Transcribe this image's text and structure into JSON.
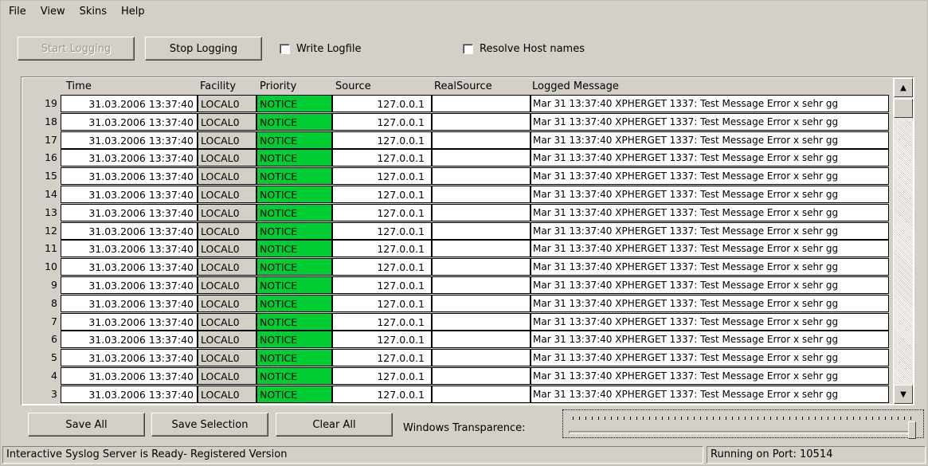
{
  "menu": {
    "file": "File",
    "view": "View",
    "skins": "Skins",
    "help": "Help"
  },
  "toolbar": {
    "start_logging": "Start Logging",
    "stop_logging": "Stop Logging",
    "write_logfile": "Write Logfile",
    "resolve_host_names": "Resolve Host names"
  },
  "table": {
    "columns": {
      "time": "Time",
      "facility": "Facility",
      "priority": "Priority",
      "source": "Source",
      "realsource": "RealSource",
      "message": "Logged Message"
    },
    "priority_color": "#00cc33",
    "rows": [
      {
        "num": "19",
        "time": "31.03.2006 13:37:40",
        "facility": "LOCAL0",
        "priority": "NOTICE",
        "source": "127.0.0.1",
        "realsource": "",
        "message": "Mar 31 13:37:40 XPHERGET 1337: Test Message Error x sehr gg"
      },
      {
        "num": "18",
        "time": "31.03.2006 13:37:40",
        "facility": "LOCAL0",
        "priority": "NOTICE",
        "source": "127.0.0.1",
        "realsource": "",
        "message": "Mar 31 13:37:40 XPHERGET 1337: Test Message Error x sehr gg"
      },
      {
        "num": "17",
        "time": "31.03.2006 13:37:40",
        "facility": "LOCAL0",
        "priority": "NOTICE",
        "source": "127.0.0.1",
        "realsource": "",
        "message": "Mar 31 13:37:40 XPHERGET 1337: Test Message Error x sehr gg"
      },
      {
        "num": "16",
        "time": "31.03.2006 13:37:40",
        "facility": "LOCAL0",
        "priority": "NOTICE",
        "source": "127.0.0.1",
        "realsource": "",
        "message": "Mar 31 13:37:40 XPHERGET 1337: Test Message Error x sehr gg"
      },
      {
        "num": "15",
        "time": "31.03.2006 13:37:40",
        "facility": "LOCAL0",
        "priority": "NOTICE",
        "source": "127.0.0.1",
        "realsource": "",
        "message": "Mar 31 13:37:40 XPHERGET 1337: Test Message Error x sehr gg"
      },
      {
        "num": "14",
        "time": "31.03.2006 13:37:40",
        "facility": "LOCAL0",
        "priority": "NOTICE",
        "source": "127.0.0.1",
        "realsource": "",
        "message": "Mar 31 13:37:40 XPHERGET 1337: Test Message Error x sehr gg"
      },
      {
        "num": "13",
        "time": "31.03.2006 13:37:40",
        "facility": "LOCAL0",
        "priority": "NOTICE",
        "source": "127.0.0.1",
        "realsource": "",
        "message": "Mar 31 13:37:40 XPHERGET 1337: Test Message Error x sehr gg"
      },
      {
        "num": "12",
        "time": "31.03.2006 13:37:40",
        "facility": "LOCAL0",
        "priority": "NOTICE",
        "source": "127.0.0.1",
        "realsource": "",
        "message": "Mar 31 13:37:40 XPHERGET 1337: Test Message Error x sehr gg"
      },
      {
        "num": "11",
        "time": "31.03.2006 13:37:40",
        "facility": "LOCAL0",
        "priority": "NOTICE",
        "source": "127.0.0.1",
        "realsource": "",
        "message": "Mar 31 13:37:40 XPHERGET 1337: Test Message Error x sehr gg"
      },
      {
        "num": "10",
        "time": "31.03.2006 13:37:40",
        "facility": "LOCAL0",
        "priority": "NOTICE",
        "source": "127.0.0.1",
        "realsource": "",
        "message": "Mar 31 13:37:40 XPHERGET 1337: Test Message Error x sehr gg"
      },
      {
        "num": "9",
        "time": "31.03.2006 13:37:40",
        "facility": "LOCAL0",
        "priority": "NOTICE",
        "source": "127.0.0.1",
        "realsource": "",
        "message": "Mar 31 13:37:40 XPHERGET 1337: Test Message Error x sehr gg"
      },
      {
        "num": "8",
        "time": "31.03.2006 13:37:40",
        "facility": "LOCAL0",
        "priority": "NOTICE",
        "source": "127.0.0.1",
        "realsource": "",
        "message": "Mar 31 13:37:40 XPHERGET 1337: Test Message Error x sehr gg"
      },
      {
        "num": "7",
        "time": "31.03.2006 13:37:40",
        "facility": "LOCAL0",
        "priority": "NOTICE",
        "source": "127.0.0.1",
        "realsource": "",
        "message": "Mar 31 13:37:40 XPHERGET 1337: Test Message Error x sehr gg"
      },
      {
        "num": "6",
        "time": "31.03.2006 13:37:40",
        "facility": "LOCAL0",
        "priority": "NOTICE",
        "source": "127.0.0.1",
        "realsource": "",
        "message": "Mar 31 13:37:40 XPHERGET 1337: Test Message Error x sehr gg"
      },
      {
        "num": "5",
        "time": "31.03.2006 13:37:40",
        "facility": "LOCAL0",
        "priority": "NOTICE",
        "source": "127.0.0.1",
        "realsource": "",
        "message": "Mar 31 13:37:40 XPHERGET 1337: Test Message Error x sehr gg"
      },
      {
        "num": "4",
        "time": "31.03.2006 13:37:40",
        "facility": "LOCAL0",
        "priority": "NOTICE",
        "source": "127.0.0.1",
        "realsource": "",
        "message": "Mar 31 13:37:40 XPHERGET 1337: Test Message Error x sehr gg"
      },
      {
        "num": "3",
        "time": "31.03.2006 13:37:40",
        "facility": "LOCAL0",
        "priority": "NOTICE",
        "source": "127.0.0.1",
        "realsource": "",
        "message": "Mar 31 13:37:40 XPHERGET 1337: Test Message Error x sehr gg"
      }
    ]
  },
  "bottom": {
    "save_all": "Save All",
    "save_selection": "Save Selection",
    "clear_all": "Clear All",
    "transparence_label": "Windows Transparence:",
    "transparence_level_percent": 100
  },
  "status": {
    "left": "Interactive Syslog Server is Ready- Registered Version",
    "right": "Running on Port: 10514"
  }
}
